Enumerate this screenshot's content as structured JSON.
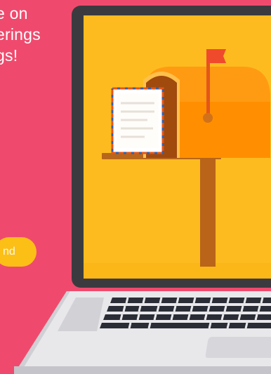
{
  "promo": {
    "lines": [
      "e on",
      "erings",
      "gs!"
    ]
  },
  "cta": {
    "label": "nd"
  },
  "colors": {
    "background": "#ef4a6d",
    "accent": "#fcbf16",
    "laptop_frame": "#3b3b3f",
    "screen": "#fdbb1f",
    "mailbox": "#ff8f00"
  }
}
